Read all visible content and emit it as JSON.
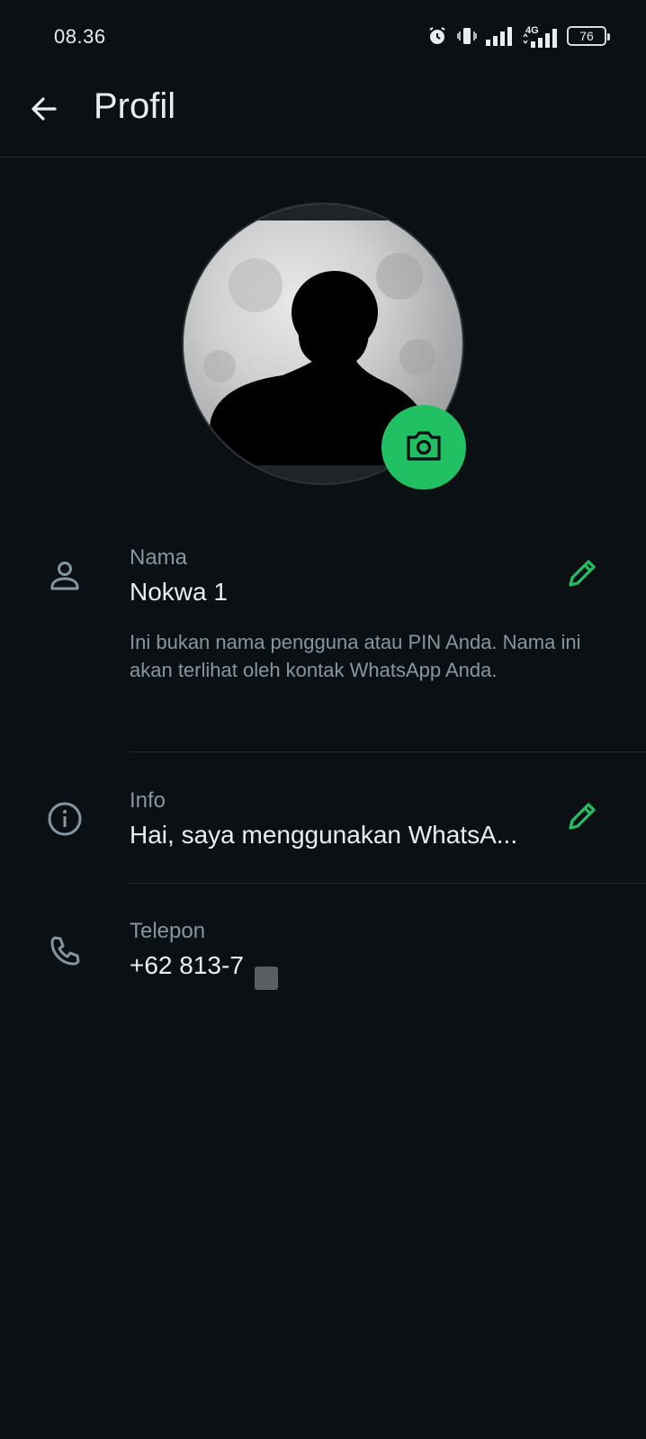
{
  "status_bar": {
    "time": "08.36",
    "battery": "76",
    "network": "4G",
    "icons": [
      "alarm-icon",
      "vibrate-icon",
      "signal-icon",
      "signal-4g-icon",
      "battery-icon"
    ]
  },
  "appbar": {
    "title": "Profil",
    "back_icon": "arrow-left-icon"
  },
  "colors": {
    "background": "#0b1014",
    "accent": "#21c063",
    "text_primary": "#e9edef",
    "text_secondary": "#8696a0"
  },
  "profile": {
    "camera_icon": "camera-icon",
    "name": {
      "label": "Nama",
      "value": "Nokwa 1",
      "hint": "Ini bukan nama pengguna atau PIN Anda. Nama ini akan terlihat oleh kontak WhatsApp Anda.",
      "icon": "person-icon",
      "edit_icon": "pencil-icon"
    },
    "about": {
      "label": "Info",
      "value": "Hai, saya menggunakan WhatsA...",
      "icon": "info-icon",
      "edit_icon": "pencil-icon"
    },
    "phone": {
      "label": "Telepon",
      "value": "+62 813-7",
      "icon": "phone-icon"
    }
  }
}
